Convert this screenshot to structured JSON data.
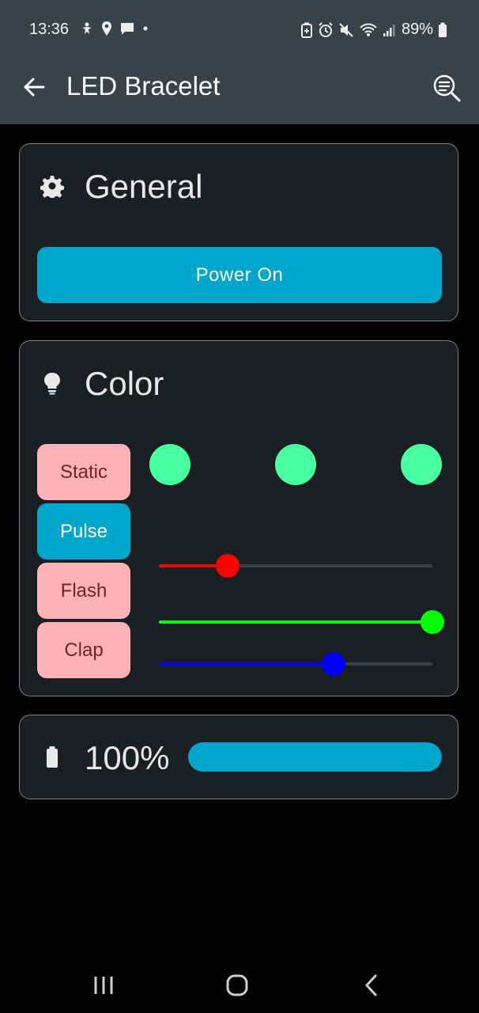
{
  "status_bar": {
    "time": "13:36",
    "battery": "89%"
  },
  "app_bar": {
    "title": "LED Bracelet"
  },
  "general": {
    "title": "General",
    "power_label": "Power On"
  },
  "color": {
    "title": "Color",
    "modes": [
      {
        "label": "Static",
        "active": false
      },
      {
        "label": "Pulse",
        "active": true
      },
      {
        "label": "Flash",
        "active": false
      },
      {
        "label": "Clap",
        "active": false
      }
    ],
    "swatch_color": "#47ffa0",
    "sliders": [
      {
        "channel": "red",
        "color": "#ff0000",
        "value": 0.25
      },
      {
        "channel": "green",
        "color": "#00ff00",
        "value": 1.0
      },
      {
        "channel": "blue",
        "color": "#0000ff",
        "value": 0.64
      }
    ]
  },
  "battery": {
    "level_label": "100%",
    "level": 1.0
  },
  "colors": {
    "accent": "#00a5cc",
    "mode_inactive": "#ffb3b8",
    "app_bar": "#37424a"
  }
}
